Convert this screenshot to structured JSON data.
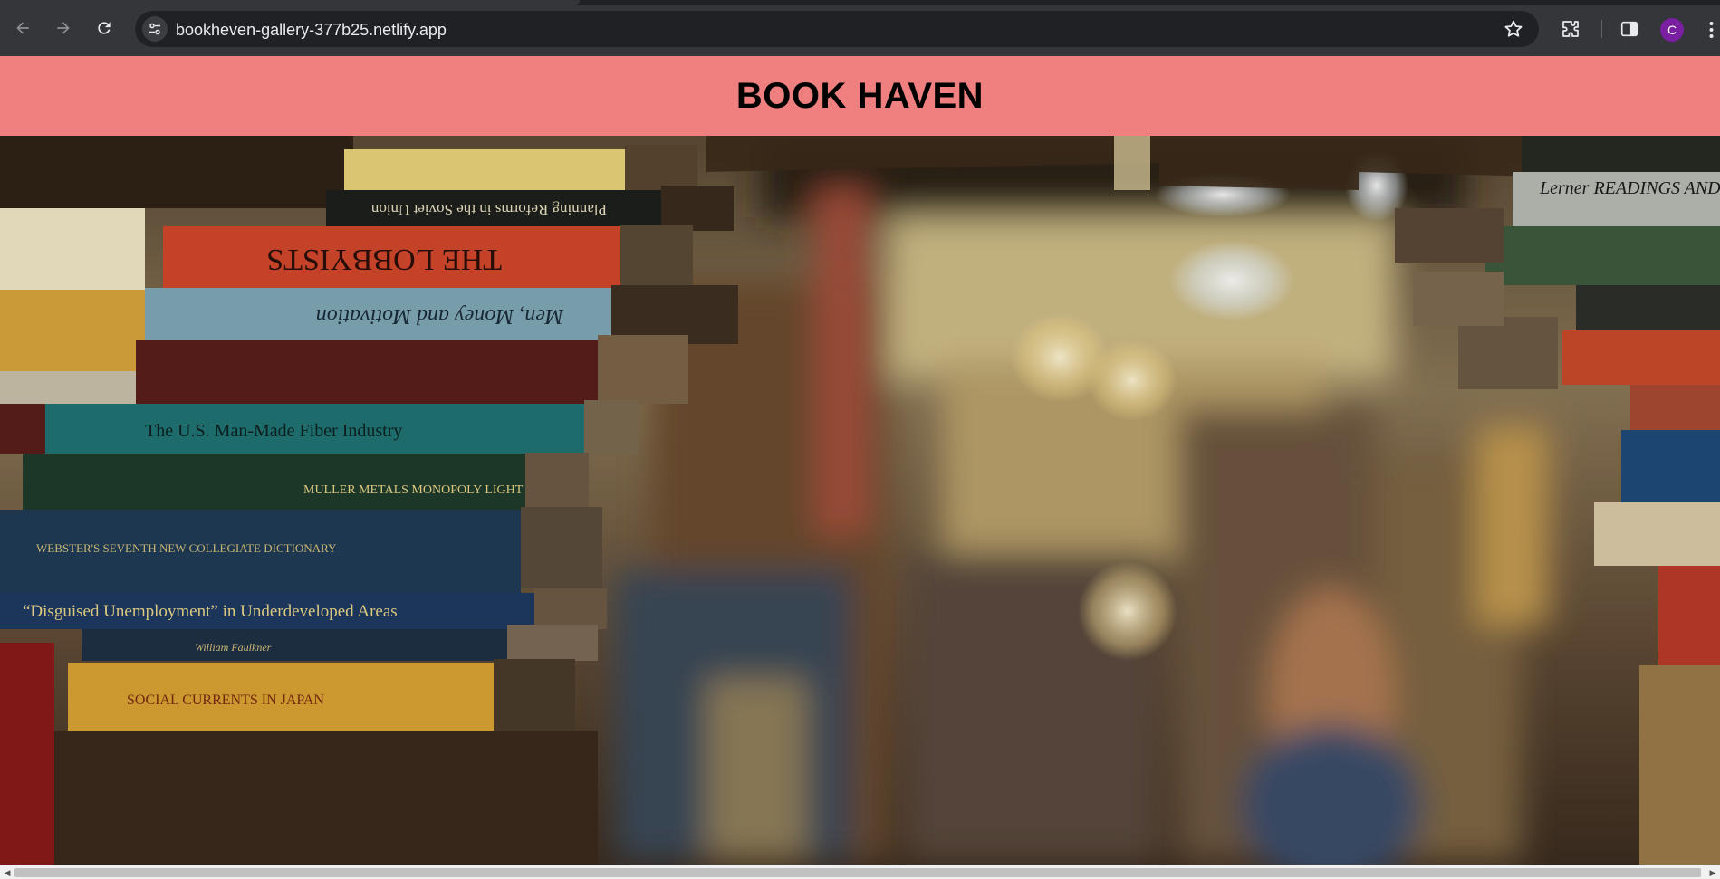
{
  "browser": {
    "url": "bookheven-gallery-377b25.netlify.app",
    "profile_initial": "C",
    "icons": {
      "back": "arrow-left-icon",
      "forward": "arrow-right-icon",
      "reload": "reload-icon",
      "site_info": "tune-icon",
      "bookmark": "star-icon",
      "extensions": "puzzle-icon",
      "side_panel": "side-panel-icon",
      "menu": "more-vert-icon"
    },
    "colors": {
      "frame": "#35363a",
      "omnibox": "#202124",
      "avatar": "#7b1fa2"
    }
  },
  "page": {
    "header": {
      "title": "BOOK HAVEN",
      "background": "#f08080"
    },
    "hero": {
      "description": "bookshop-hero-image",
      "spines": {
        "blue": "Men, Money and Motivation",
        "teal": "The U.S. Man-Made Fiber Industry",
        "navy": "“Disguised Unemployment” in Underdeveloped Areas",
        "red": "THE LOBBYISTS",
        "black": "Planning Reforms in the Soviet Union",
        "dark_green": "MULLER  METALS MONOPOLY  LIGHT",
        "dict": "WEBSTER'S SEVENTH NEW COLLEGIATE DICTIONARY",
        "yellow": "SOCIAL CURRENTS IN JAPAN",
        "right_grey": "Lerner  READINGS AND INV",
        "small_blue": "William Faulkner"
      }
    }
  }
}
